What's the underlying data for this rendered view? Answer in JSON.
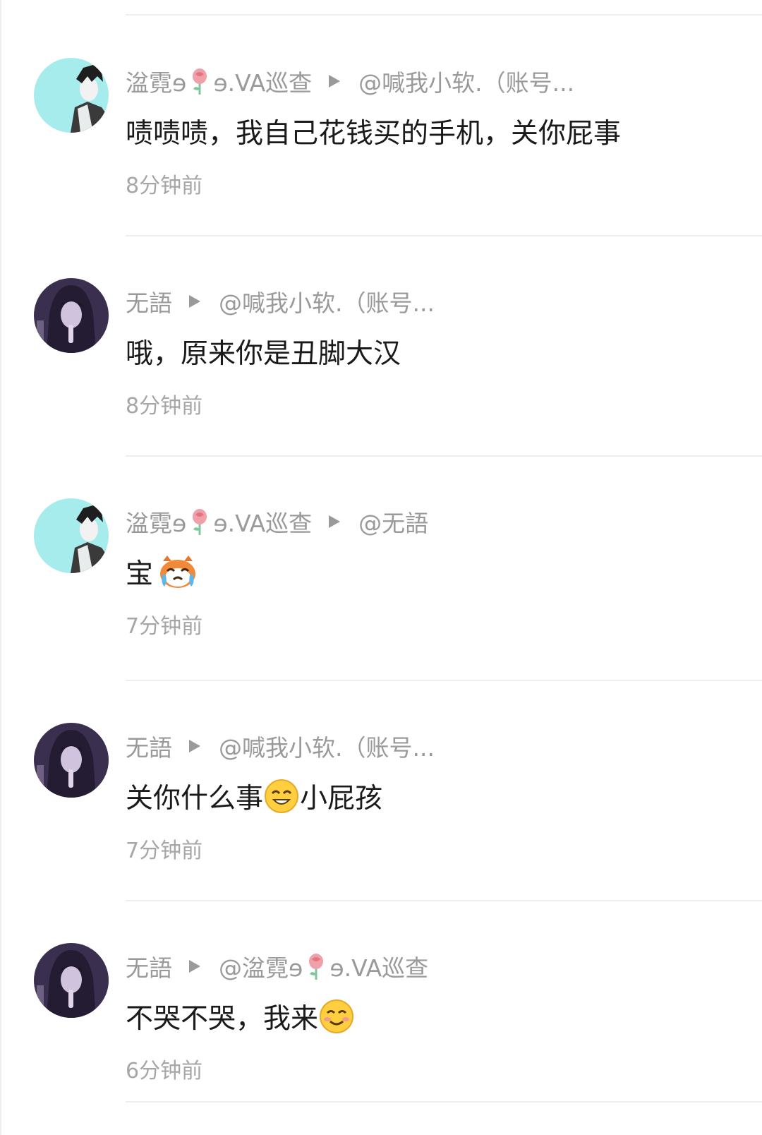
{
  "comments": [
    {
      "author_pre": "湓霓ɘ",
      "author_post": "ɘ.VA巡查",
      "reply_to": "@喊我小软.（账号...",
      "text": "啧啧啧，我自己花钱买的手机，关你屁事",
      "time": "8分钟前"
    },
    {
      "author_pre": "无語",
      "reply_to": "@喊我小软.（账号...",
      "text": "哦，原来你是丑脚大汉",
      "time": "8分钟前"
    },
    {
      "author_pre": "湓霓ɘ",
      "author_post": "ɘ.VA巡查",
      "reply_to": "@无語",
      "text": "宝",
      "time": "7分钟前"
    },
    {
      "author_pre": "无語",
      "reply_to": "@喊我小软.（账号...",
      "text_a": "关你什么事",
      "text_b": "小屁孩",
      "time": "7分钟前"
    },
    {
      "author_pre": "无語",
      "reply_pre": "@湓霓ɘ",
      "reply_post": "ɘ.VA巡查",
      "text": "不哭不哭，我来",
      "time": "6分钟前"
    }
  ],
  "colors": {
    "meta": "#9a9a9a",
    "text": "#1a1a1a",
    "time": "#a6a6a6",
    "divider": "#eeeeee"
  },
  "icons": [
    "rose-icon",
    "reply-arrow-icon",
    "crying-emoji-icon",
    "smile-emoji-icon",
    "blush-emoji-icon"
  ]
}
